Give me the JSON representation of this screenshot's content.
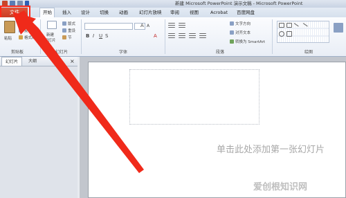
{
  "titlebar": {
    "title": "新建 Microsoft PowerPoint 演示文稿 - Microsoft PowerPoint"
  },
  "tabs": {
    "file": "文件",
    "home": "开始",
    "insert": "插入",
    "design": "设计",
    "transitions": "切换",
    "animations": "动画",
    "slideshow": "幻灯片放映",
    "review": "审阅",
    "view": "视图",
    "acrobat": "Acrobat",
    "baidu": "百度网盘"
  },
  "ribbon": {
    "clipboard": {
      "paste": "粘贴",
      "cut": "剪切",
      "copy": "复制",
      "format_painter": "格式刷",
      "label": "剪贴板"
    },
    "slides": {
      "new_slide_line1": "新建",
      "new_slide_line2": "幻灯片",
      "layout": "版式",
      "reset": "重设",
      "section": "节",
      "label": "幻灯片"
    },
    "font": {
      "label": "字体"
    },
    "paragraph": {
      "text_direction": "文字方向",
      "align_text": "对齐文本",
      "smartart": "转换为 SmartArt",
      "label": "段落"
    },
    "drawing": {
      "label": "绘图"
    }
  },
  "panel": {
    "slides_tab": "幻灯片",
    "outline_tab": "大纲",
    "close": "×"
  },
  "slide": {
    "placeholder": "单击此处添加第一张幻灯片"
  },
  "watermark": "爱创根知识网"
}
